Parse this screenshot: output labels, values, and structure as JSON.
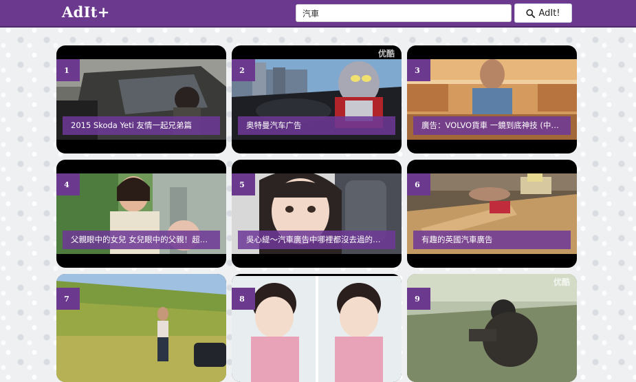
{
  "header": {
    "logo": "AdIt+",
    "search": {
      "value": "汽車",
      "placeholder": ""
    },
    "search_button_label": "AdIt!",
    "search_icon": "search-icon"
  },
  "videos": [
    {
      "rank": "1",
      "title": "2015 Skoda Yeti 友情一起兄弟篇",
      "watermark": ""
    },
    {
      "rank": "2",
      "title": "奥特曼汽车广告",
      "watermark": "优酷"
    },
    {
      "rank": "3",
      "title": "廣告：VOLVO貨車 一鏡到底神技 (中文...",
      "watermark": ""
    },
    {
      "rank": "4",
      "title": "父親眼中的女兒 女兒眼中的父親！超感...",
      "watermark": ""
    },
    {
      "rank": "5",
      "title": "吳心緹～汽車廣告中哪裡都沒去過的小...",
      "watermark": ""
    },
    {
      "rank": "6",
      "title": "有趣的英國汽車廣告",
      "watermark": ""
    },
    {
      "rank": "7",
      "title": "",
      "watermark": ""
    },
    {
      "rank": "8",
      "title": "",
      "watermark": ""
    },
    {
      "rank": "9",
      "title": "",
      "watermark": "优酷"
    }
  ]
}
